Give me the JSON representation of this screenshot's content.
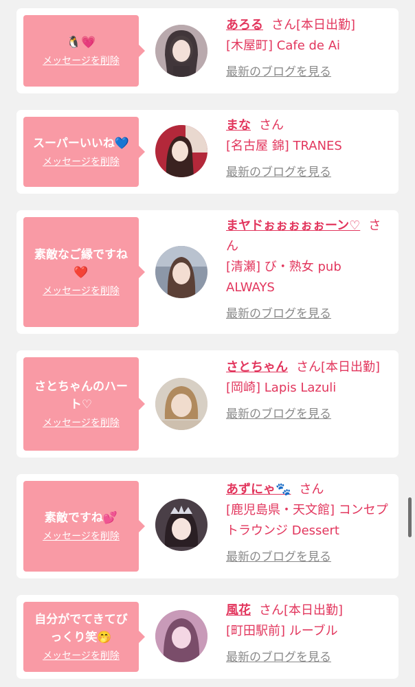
{
  "accent_color": "#e2365d",
  "bubble_color": "#f99aa5",
  "delete_label": "メッセージを削除",
  "blog_label": "最新のブログを見る",
  "san_label": "さん",
  "cards": [
    {
      "message": "🐧💗",
      "name": "あろる",
      "status": "[本日出勤]",
      "shop": "[木屋町] Cafe de Ai"
    },
    {
      "message": "スーパーいいね💙",
      "name": "まな",
      "status": "",
      "shop": "[名古屋 錦] TRANES"
    },
    {
      "message": "素敵なご縁ですね❤️",
      "name": "まヤドぉぉぉぉぉーン♡",
      "status": "",
      "shop": "[清瀬] び・熟女 pub ALWAYS"
    },
    {
      "message": "さとちゃんのハート♡",
      "name": "さとちゃん",
      "status": "[本日出勤]",
      "shop": "[岡崎] Lapis Lazuli"
    },
    {
      "message": "素敵ですね💕",
      "name": "あずにゃ🐾",
      "status": "",
      "shop": "[鹿児島県・天文館] コンセプトラウンジ Dessert"
    },
    {
      "message": "自分がでてきてびっくり笑🤭",
      "name": "風花",
      "status": "[本日出勤]",
      "shop": "[町田駅前] ルーブル"
    }
  ]
}
